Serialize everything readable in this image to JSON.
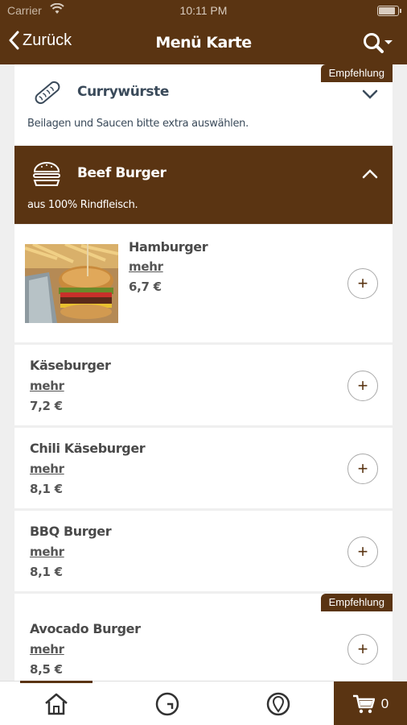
{
  "status": {
    "carrier": "Carrier",
    "time": "10:11 PM",
    "battery_level": 0.92
  },
  "nav": {
    "back_label": "Zurück",
    "title": "Menü Karte"
  },
  "colors": {
    "brand": "#5a3412",
    "text_dark": "#3a4a5a",
    "white": "#ffffff"
  },
  "categories": [
    {
      "title": "Currywürste",
      "description": "Beilagen und Saucen bitte extra auswählen.",
      "badge": "Empfehlung",
      "icon": "sausage-icon",
      "expanded": false
    },
    {
      "title": "Beef Burger",
      "description": "aus 100% Rindfleisch.",
      "icon": "burger-icon",
      "expanded": true
    }
  ],
  "items": [
    {
      "name": "Hamburger",
      "more": "mehr",
      "price": "6,7 €",
      "has_image": true
    },
    {
      "name": "Käseburger",
      "more": "mehr",
      "price": "7,2 €"
    },
    {
      "name": "Chili Käseburger",
      "more": "mehr",
      "price": "8,1 €"
    },
    {
      "name": "BBQ Burger",
      "more": "mehr",
      "price": "8,1 €"
    },
    {
      "name": "Avocado Burger",
      "more": "mehr",
      "price": "8,5 €",
      "badge": "Empfehlung"
    }
  ],
  "add_label": "+",
  "tabbar": {
    "cart_count": "0",
    "tabs": [
      "home-icon",
      "clock-icon",
      "location-icon"
    ]
  }
}
